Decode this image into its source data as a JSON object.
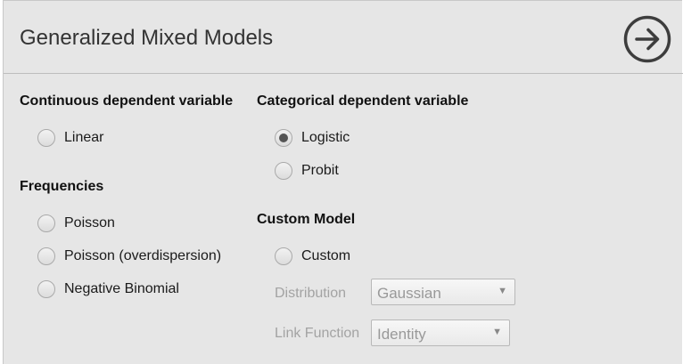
{
  "header": {
    "title": "Generalized Mixed Models",
    "run_button_icon": "arrow-right-circle-icon"
  },
  "continuous": {
    "title": "Continuous dependent variable",
    "options": [
      {
        "label": "Linear",
        "checked": false
      }
    ]
  },
  "frequencies": {
    "title": "Frequencies",
    "options": [
      {
        "label": "Poisson",
        "checked": false
      },
      {
        "label": "Poisson (overdispersion)",
        "checked": false
      },
      {
        "label": "Negative Binomial",
        "checked": false
      }
    ]
  },
  "categorical": {
    "title": "Categorical dependent variable",
    "options": [
      {
        "label": "Logistic",
        "checked": true
      },
      {
        "label": "Probit",
        "checked": false
      }
    ]
  },
  "custom_model": {
    "title": "Custom Model",
    "option": {
      "label": "Custom",
      "checked": false
    },
    "distribution": {
      "label": "Distribution",
      "value": "Gaussian"
    },
    "link_function": {
      "label": "Link Function",
      "value": "Identity"
    }
  },
  "colors": {
    "panel_bg": "#e6e6e6",
    "disabled_text": "#a3a3a3",
    "radio_dot": "#555555"
  }
}
